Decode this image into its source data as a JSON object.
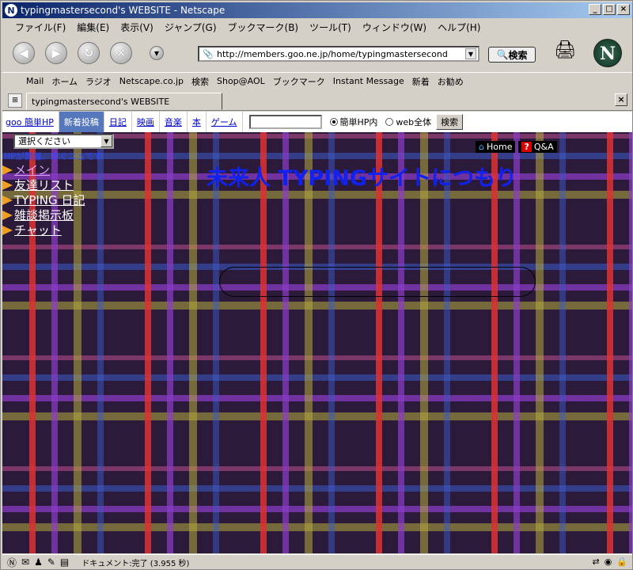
{
  "window": {
    "title": "typingmastersecond's WEBSITE - Netscape"
  },
  "menu": [
    "ファイル(F)",
    "編集(E)",
    "表示(V)",
    "ジャンプ(G)",
    "ブックマーク(B)",
    "ツール(T)",
    "ウィンドウ(W)",
    "ヘルプ(H)"
  ],
  "nav": {
    "url": "http://members.goo.ne.jp/home/typingmastersecond",
    "search_label": "検索"
  },
  "personal": [
    "Mail",
    "ホーム",
    "ラジオ",
    "Netscape.co.jp",
    "検索",
    "Shop@AOL",
    "ブックマーク",
    "Instant Message",
    "新着",
    "お勧め"
  ],
  "tab": {
    "label": "typingmastersecond's WEBSITE"
  },
  "goo": {
    "items": [
      "goo 簡単HP",
      "新着投稿",
      "日記",
      "映画",
      "音楽",
      "本",
      "ゲーム"
    ],
    "radio1": "簡単HP内",
    "radio2": "web全体",
    "search_btn": "検索"
  },
  "page": {
    "select": "選択ください",
    "notice": "HPが開催、まぐニュです",
    "title": "未来人 TYPINGサイトにつもり",
    "home": "Home",
    "qa": "Q&A",
    "links": [
      "メイン",
      "友達リスト",
      "TYPING 日記",
      "雑談掲示板",
      "チャット"
    ]
  },
  "status": {
    "text": "ドキュメント:完了 (3.955 秒)"
  }
}
